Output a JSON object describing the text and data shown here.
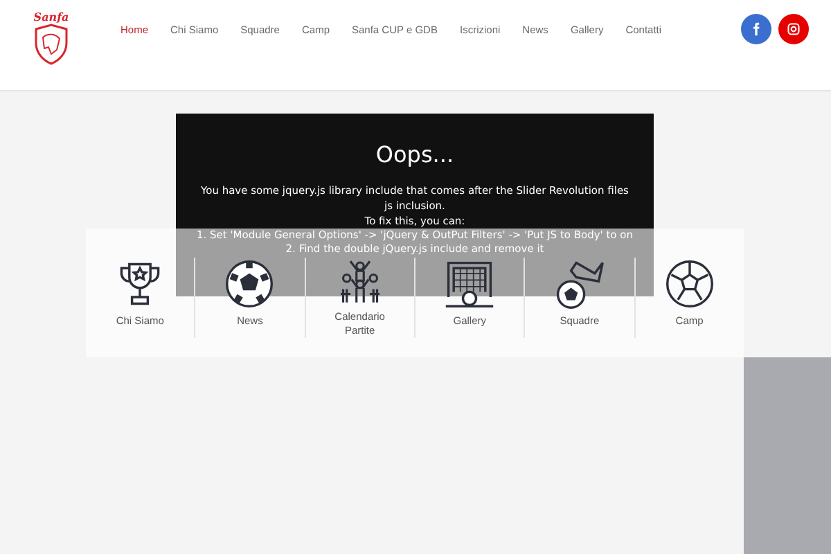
{
  "header": {
    "logo_text": "Sanfa",
    "nav": [
      {
        "label": "Home",
        "selected": true
      },
      {
        "label": "Chi Siamo",
        "selected": false
      },
      {
        "label": "Squadre",
        "selected": false
      },
      {
        "label": "Camp",
        "selected": false
      },
      {
        "label": "Sanfa CUP e GDB",
        "selected": false
      },
      {
        "label": "Iscrizioni",
        "selected": false
      },
      {
        "label": "News",
        "selected": false
      },
      {
        "label": "Gallery",
        "selected": false
      },
      {
        "label": "Contatti",
        "selected": false
      }
    ],
    "social": [
      {
        "kind": "facebook",
        "color": "#3a6fcf"
      },
      {
        "kind": "instagram",
        "color": "#e60000"
      }
    ]
  },
  "error_box": {
    "title": "Oops...",
    "message": "You have some jquery.js library include that comes after the Slider Revolution files js inclusion.",
    "fix_intro": "To fix this, you can:",
    "steps": [
      "1. Set 'Module General Options' -> 'jQuery & OutPut Filters' -> 'Put JS to Body' to on",
      "2. Find the double jQuery.js include and remove it"
    ]
  },
  "quick_links": [
    {
      "kind": "trophy",
      "label": "Chi Siamo"
    },
    {
      "kind": "ball",
      "label": "News"
    },
    {
      "kind": "fans",
      "label": "Calendario Partite"
    },
    {
      "kind": "goal",
      "label": "Gallery"
    },
    {
      "kind": "boot",
      "label": "Squadre"
    },
    {
      "kind": "ball-outline",
      "label": "Camp"
    }
  ]
}
